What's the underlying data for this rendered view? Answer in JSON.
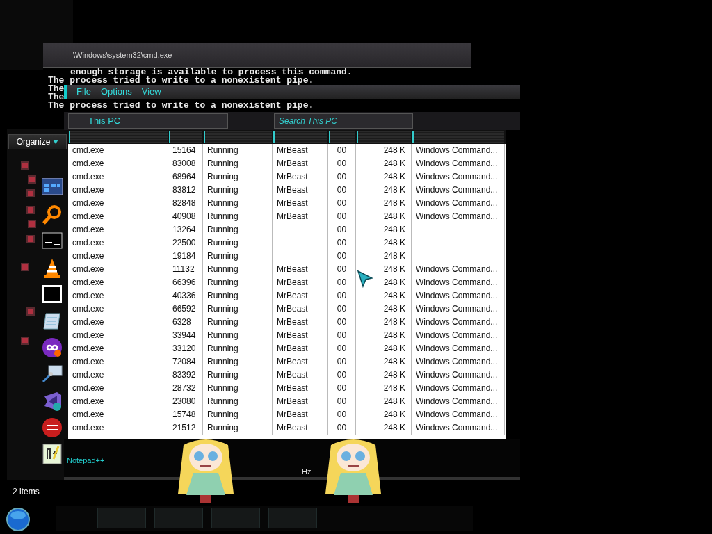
{
  "console": {
    "title": "\\Windows\\system32\\cmd.exe",
    "lines": [
      {
        "text": "enough storage is available to process this command."
      },
      {
        "text": "The process tried to write to a nonexistent pipe."
      },
      {
        "text": "The"
      },
      {
        "text": "The"
      },
      {
        "text": "The process tried to write to a nonexistent pipe."
      }
    ]
  },
  "explorer": {
    "organize": "Organize",
    "status": "2 items"
  },
  "task_window": {
    "menu": [
      "File",
      "Options",
      "View"
    ],
    "address": "This PC",
    "search": {
      "placeholder": "Search This PC"
    },
    "rows": [
      {
        "name": "cmd.exe",
        "pid": "15164",
        "status": "Running",
        "user": "MrBeast",
        "cpu": "00",
        "memory": "248 K",
        "description": "Windows Command..."
      },
      {
        "name": "cmd.exe",
        "pid": "83008",
        "status": "Running",
        "user": "MrBeast",
        "cpu": "00",
        "memory": "248 K",
        "description": "Windows Command..."
      },
      {
        "name": "cmd.exe",
        "pid": "68964",
        "status": "Running",
        "user": "MrBeast",
        "cpu": "00",
        "memory": "248 K",
        "description": "Windows Command..."
      },
      {
        "name": "cmd.exe",
        "pid": "83812",
        "status": "Running",
        "user": "MrBeast",
        "cpu": "00",
        "memory": "248 K",
        "description": "Windows Command..."
      },
      {
        "name": "cmd.exe",
        "pid": "82848",
        "status": "Running",
        "user": "MrBeast",
        "cpu": "00",
        "memory": "248 K",
        "description": "Windows Command..."
      },
      {
        "name": "cmd.exe",
        "pid": "40908",
        "status": "Running",
        "user": "MrBeast",
        "cpu": "00",
        "memory": "248 K",
        "description": "Windows Command..."
      },
      {
        "name": "cmd.exe",
        "pid": "13264",
        "status": "Running",
        "cpu": "00",
        "memory": "248 K"
      },
      {
        "name": "cmd.exe",
        "pid": "22500",
        "status": "Running",
        "cpu": "00",
        "memory": "248 K"
      },
      {
        "name": "cmd.exe",
        "pid": "19184",
        "status": "Running",
        "cpu": "00",
        "memory": "248 K"
      },
      {
        "name": "cmd.exe",
        "pid": "11132",
        "status": "Running",
        "user": "MrBeast",
        "cpu": "00",
        "memory": "248 K",
        "description": "Windows Command..."
      },
      {
        "name": "cmd.exe",
        "pid": "66396",
        "status": "Running",
        "user": "MrBeast",
        "cpu": "00",
        "memory": "248 K",
        "description": "Windows Command..."
      },
      {
        "name": "cmd.exe",
        "pid": "40336",
        "status": "Running",
        "user": "MrBeast",
        "cpu": "00",
        "memory": "248 K",
        "description": "Windows Command..."
      },
      {
        "name": "cmd.exe",
        "pid": "66592",
        "status": "Running",
        "user": "MrBeast",
        "cpu": "00",
        "memory": "248 K",
        "description": "Windows Command..."
      },
      {
        "name": "cmd.exe",
        "pid": "6328",
        "status": "Running",
        "user": "MrBeast",
        "cpu": "00",
        "memory": "248 K",
        "description": "Windows Command..."
      },
      {
        "name": "cmd.exe",
        "pid": "33944",
        "status": "Running",
        "user": "MrBeast",
        "cpu": "00",
        "memory": "248 K",
        "description": "Windows Command..."
      },
      {
        "name": "cmd.exe",
        "pid": "33120",
        "status": "Running",
        "user": "MrBeast",
        "cpu": "00",
        "memory": "248 K",
        "description": "Windows Command..."
      },
      {
        "name": "cmd.exe",
        "pid": "72084",
        "status": "Running",
        "user": "MrBeast",
        "cpu": "00",
        "memory": "248 K",
        "description": "Windows Command..."
      },
      {
        "name": "cmd.exe",
        "pid": "83392",
        "status": "Running",
        "user": "MrBeast",
        "cpu": "00",
        "memory": "248 K",
        "description": "Windows Command..."
      },
      {
        "name": "cmd.exe",
        "pid": "28732",
        "status": "Running",
        "user": "MrBeast",
        "cpu": "00",
        "memory": "248 K",
        "description": "Windows Command..."
      },
      {
        "name": "cmd.exe",
        "pid": "23080",
        "status": "Running",
        "user": "MrBeast",
        "cpu": "00",
        "memory": "248 K",
        "description": "Windows Command..."
      },
      {
        "name": "cmd.exe",
        "pid": "15748",
        "status": "Running",
        "user": "MrBeast",
        "cpu": "00",
        "memory": "248 K",
        "description": "Windows Command..."
      },
      {
        "name": "cmd.exe",
        "pid": "21512",
        "status": "Running",
        "user": "MrBeast",
        "cpu": "00",
        "memory": "248 K",
        "description": "Windows Command..."
      }
    ],
    "taskbar_label": "Notepad++",
    "fragment": "Hz"
  }
}
